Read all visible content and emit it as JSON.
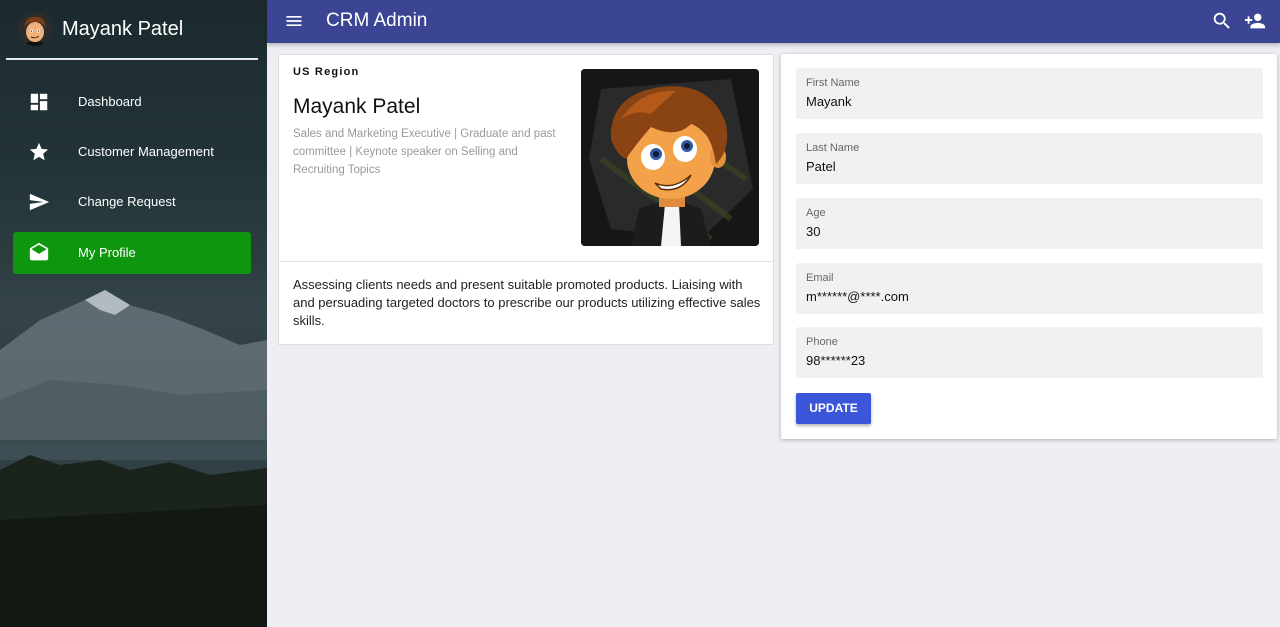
{
  "sidebar": {
    "user_name": "Mayank Patel",
    "items": [
      {
        "label": "Dashboard",
        "icon": "dashboard-icon"
      },
      {
        "label": "Customer Management",
        "icon": "star-icon"
      },
      {
        "label": "Change Request",
        "icon": "send-icon"
      },
      {
        "label": "My Profile",
        "icon": "drafts-icon",
        "active": true
      }
    ],
    "active_color": "#0f960f"
  },
  "topbar": {
    "title": "CRM Admin",
    "color": "#3b4593"
  },
  "profile": {
    "region": "US Region",
    "name": "Mayank Patel",
    "description": "Sales and Marketing Executive | Graduate and past committee | Keynote speaker on Selling and Recruiting Topics",
    "about": "Assessing clients needs and present suitable promoted products. Liaising with and persuading targeted doctors to prescribe our products utilizing effective sales skills."
  },
  "form": {
    "fields": [
      {
        "label": "First Name",
        "value": "Mayank"
      },
      {
        "label": "Last Name",
        "value": "Patel"
      },
      {
        "label": "Age",
        "value": "30"
      },
      {
        "label": "Email",
        "value": "m******@****.com"
      },
      {
        "label": "Phone",
        "value": "98******23"
      }
    ],
    "update_label": "UPDATE",
    "button_color": "#3b56d9"
  }
}
